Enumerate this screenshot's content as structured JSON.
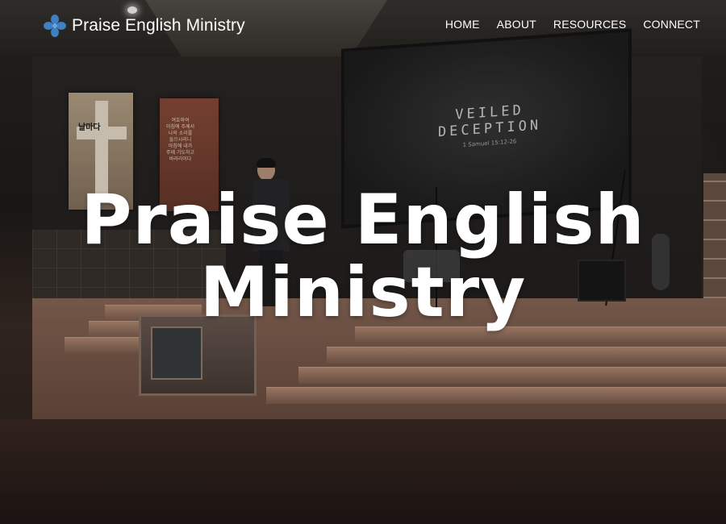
{
  "header": {
    "logo_text": "Praise English Ministry",
    "logo_icon": "blue-flower-logo-icon",
    "nav": [
      {
        "label": "HOME"
      },
      {
        "label": "ABOUT"
      },
      {
        "label": "RESOURCES"
      },
      {
        "label": "CONNECT"
      }
    ]
  },
  "hero": {
    "title_line1": "Praise English",
    "title_line2": "Ministry",
    "background": {
      "screen_title": "VEILED\nDECEPTION",
      "screen_subtitle": "1 Samuel 15:12-26",
      "banner_left_text": "날마다",
      "banner_right_text": "여호와여\n아침에 주께서\n나의 소리를\n들으시리니\n아침에 내가\n주께 기도하고\n바라리이다"
    }
  },
  "colors": {
    "logo_blue": "#3f7fc4",
    "text": "#ffffff"
  }
}
